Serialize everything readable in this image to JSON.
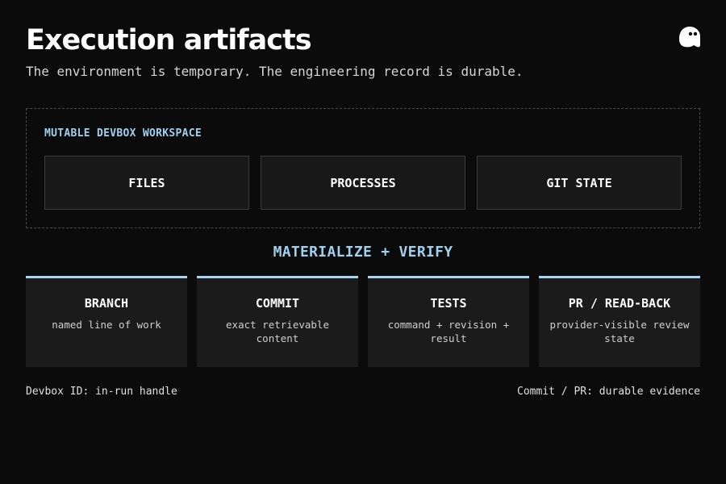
{
  "header": {
    "title": "Execution artifacts",
    "subtitle": "The environment is temporary. The engineering record is durable."
  },
  "logo": {
    "icon": "ghost-logo-icon"
  },
  "workspace": {
    "label": "MUTABLE DEVBOX WORKSPACE",
    "items": [
      "FILES",
      "PROCESSES",
      "GIT STATE"
    ]
  },
  "transition": {
    "label": "MATERIALIZE + VERIFY"
  },
  "artifacts": [
    {
      "title": "BRANCH",
      "desc": "named line of work"
    },
    {
      "title": "COMMIT",
      "desc": "exact retrievable content"
    },
    {
      "title": "TESTS",
      "desc": "command + revision + result"
    },
    {
      "title": "PR / READ-BACK",
      "desc": "provider-visible review state"
    }
  ],
  "footer": {
    "left": "Devbox ID: in-run handle",
    "right": "Commit / PR: durable evidence"
  },
  "colors": {
    "background": "#0b0b0b",
    "accent": "#9fd0ee",
    "card_border_top": "#a9d4f0"
  }
}
